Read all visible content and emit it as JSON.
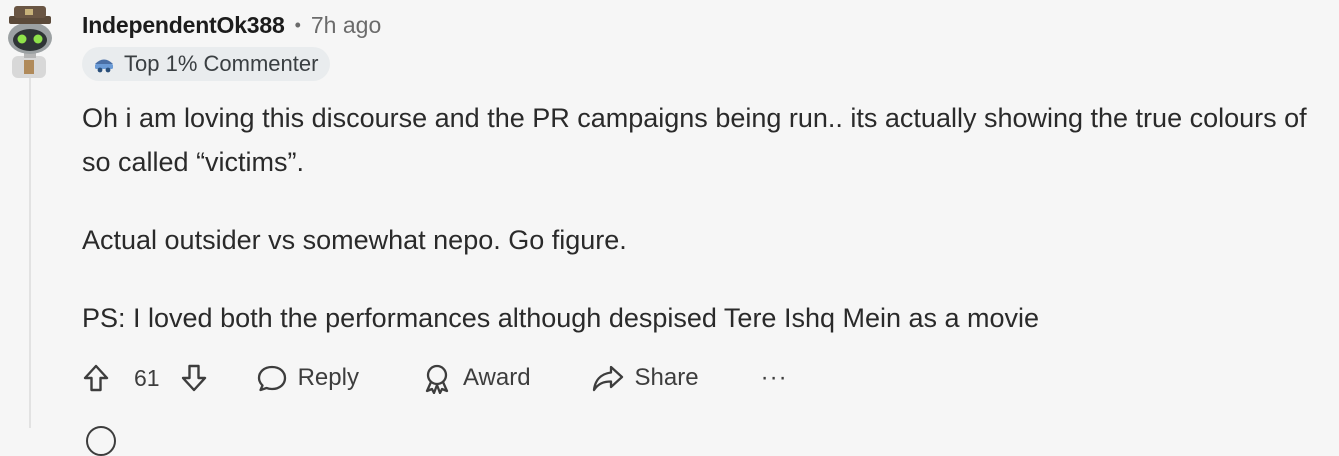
{
  "comment": {
    "username": "IndependentOk388",
    "separator": "•",
    "time": "7h ago",
    "flair": "Top 1% Commenter",
    "paragraphs": [
      "Oh i am loving this discourse and the PR campaigns being run.. its actually showing the true colours of so called “victims”.",
      "Actual outsider vs somewhat nepo. Go figure.",
      "PS: I loved both the performances although despised Tere Ishq Mein as a movie"
    ]
  },
  "actions": {
    "vote_count": "61",
    "reply_label": "Reply",
    "award_label": "Award",
    "share_label": "Share",
    "more_label": "···"
  },
  "icons": {
    "upvote": "arrow-up-icon",
    "downvote": "arrow-down-icon",
    "reply": "speech-bubble-icon",
    "award": "award-ribbon-icon",
    "share": "share-arrow-icon",
    "flair": "commenter-badge-icon"
  },
  "colors": {
    "background": "#f6f6f6",
    "text": "#1c1c1c",
    "muted": "#6b6b6b",
    "flair_bg": "#e9ecee"
  }
}
